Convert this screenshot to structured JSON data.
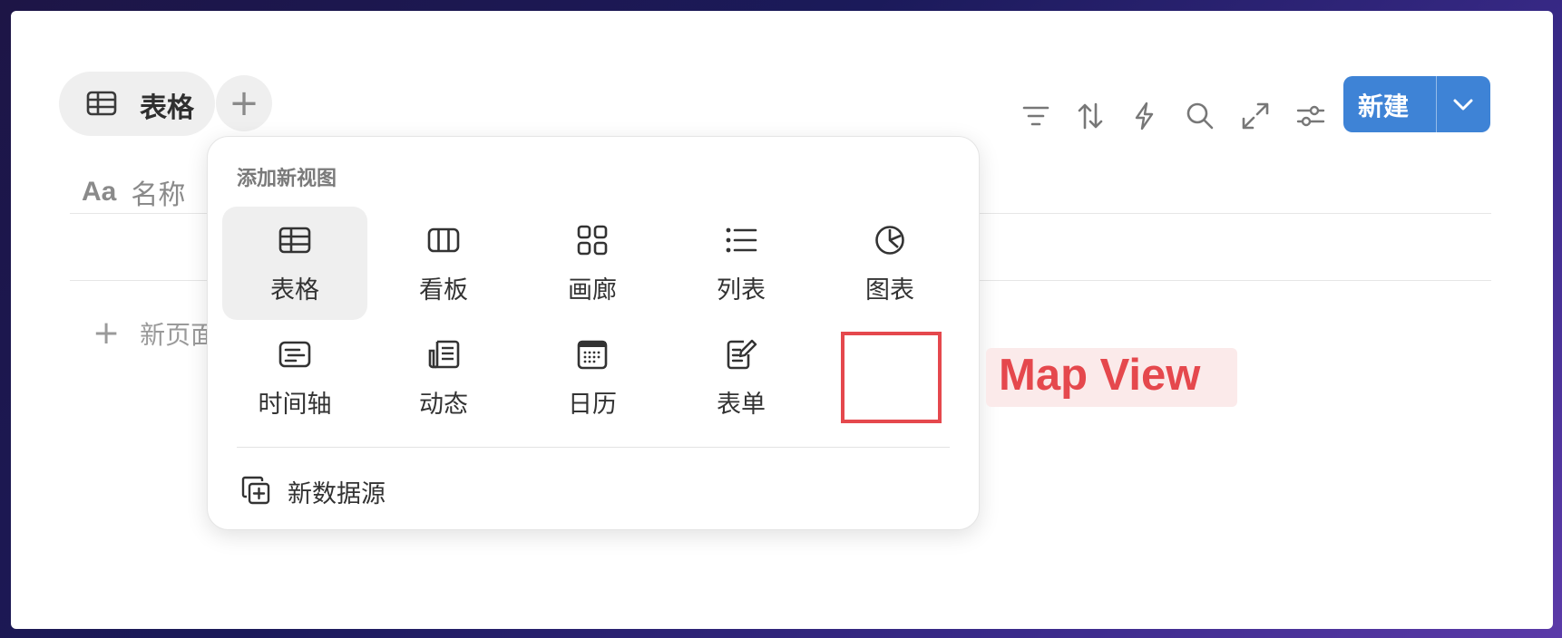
{
  "view_tabs": [
    {
      "label": "表格",
      "icon": "table-icon"
    }
  ],
  "add_view_button": "+",
  "toolbar": {
    "icons": [
      "filter-icon",
      "sort-icon",
      "automation-bolt-icon",
      "search-icon",
      "expand-icon",
      "settings-sliders-icon"
    ],
    "new_button_label": "新建"
  },
  "table": {
    "column_header": "名称",
    "column_type_icon": "Aa",
    "new_page_label": "新页面"
  },
  "popup": {
    "title": "添加新视图",
    "options": [
      {
        "label": "表格",
        "icon": "table-icon",
        "selected": true
      },
      {
        "label": "看板",
        "icon": "board-icon",
        "selected": false
      },
      {
        "label": "画廊",
        "icon": "gallery-icon",
        "selected": false
      },
      {
        "label": "列表",
        "icon": "list-icon",
        "selected": false
      },
      {
        "label": "图表",
        "icon": "chart-pie-icon",
        "selected": false
      },
      {
        "label": "时间轴",
        "icon": "timeline-icon",
        "selected": false
      },
      {
        "label": "动态",
        "icon": "feed-icon",
        "selected": false
      },
      {
        "label": "日历",
        "icon": "calendar-icon",
        "selected": false
      },
      {
        "label": "表单",
        "icon": "form-icon",
        "selected": false
      }
    ],
    "new_data_source": "新数据源"
  },
  "annotation": {
    "text": "Map View",
    "color": "#e5484d"
  },
  "colors": {
    "accent": "#3e83d6",
    "highlight": "#e5484d"
  }
}
